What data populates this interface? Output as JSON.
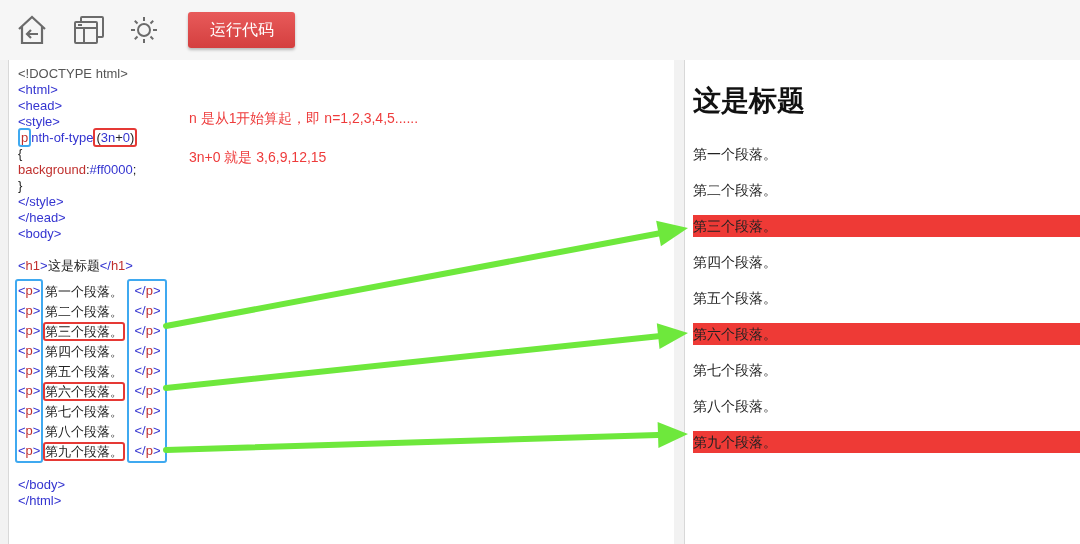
{
  "toolbar": {
    "run_button": "运行代码"
  },
  "editor": {
    "head_lines": [
      [
        {
          "text": "<!DOCTYPE html>",
          "kind": "plain"
        }
      ],
      [
        {
          "text": "<html>",
          "kind": "punct"
        }
      ],
      [
        {
          "text": "<head>",
          "kind": "punct"
        }
      ],
      [
        {
          "text": "<style>",
          "kind": "punct"
        }
      ],
      [
        {
          "text": "p",
          "kind": "tag",
          "boxed": true
        },
        {
          "text": "nth-of-type",
          "kind": "value",
          "boxed": false
        },
        {
          "kind": "group",
          "boxed": true,
          "tokens": [
            {
              "text": "(",
              "kind": "code"
            },
            {
              "text": "3n",
              "kind": "value"
            },
            {
              "text": "+",
              "kind": "code"
            },
            {
              "text": "0",
              "kind": "value"
            },
            {
              "text": ")",
              "kind": "code"
            }
          ]
        }
      ],
      [
        {
          "text": "{",
          "kind": "code"
        }
      ],
      [
        {
          "text": "background",
          "kind": "tag"
        },
        {
          "text": ":",
          "kind": "code"
        },
        {
          "text": "#ff0000",
          "kind": "value"
        },
        {
          "text": ";",
          "kind": "code"
        }
      ],
      [
        {
          "text": "}",
          "kind": "code"
        }
      ],
      [
        {
          "text": "</style>",
          "kind": "punct"
        }
      ],
      [
        {
          "text": "</head>",
          "kind": "punct"
        }
      ],
      [
        {
          "text": "<body>",
          "kind": "punct"
        }
      ]
    ],
    "heading_line": [
      {
        "text": "<",
        "kind": "punct"
      },
      {
        "text": "h1",
        "kind": "tag"
      },
      {
        "text": ">",
        "kind": "punct"
      },
      {
        "text": "这是标题",
        "kind": "code"
      },
      {
        "text": "</",
        "kind": "punct"
      },
      {
        "text": "h1",
        "kind": "tag"
      },
      {
        "text": ">",
        "kind": "punct"
      }
    ],
    "paragraph_lines": [
      {
        "open": [
          {
            "text": "<",
            "kind": "punct"
          },
          {
            "text": "p",
            "kind": "tag"
          },
          {
            "text": ">",
            "kind": "punct"
          }
        ],
        "text": "第一个段落。",
        "boxed": false,
        "close": [
          {
            "text": "</",
            "kind": "punct"
          },
          {
            "text": "p",
            "kind": "tag"
          },
          {
            "text": ">",
            "kind": "punct"
          }
        ]
      },
      {
        "open": [
          {
            "text": "<",
            "kind": "punct"
          },
          {
            "text": "p",
            "kind": "tag"
          },
          {
            "text": ">",
            "kind": "punct"
          }
        ],
        "text": "第二个段落。",
        "boxed": false,
        "close": [
          {
            "text": "</",
            "kind": "punct"
          },
          {
            "text": "p",
            "kind": "tag"
          },
          {
            "text": ">",
            "kind": "punct"
          }
        ]
      },
      {
        "open": [
          {
            "text": "<",
            "kind": "punct"
          },
          {
            "text": "p",
            "kind": "tag"
          },
          {
            "text": ">",
            "kind": "punct"
          }
        ],
        "text": "第三个段落。",
        "boxed": true,
        "close": [
          {
            "text": "</",
            "kind": "punct"
          },
          {
            "text": "p",
            "kind": "tag"
          },
          {
            "text": ">",
            "kind": "punct"
          }
        ]
      },
      {
        "open": [
          {
            "text": "<",
            "kind": "punct"
          },
          {
            "text": "p",
            "kind": "tag"
          },
          {
            "text": ">",
            "kind": "punct"
          }
        ],
        "text": "第四个段落。",
        "boxed": false,
        "close": [
          {
            "text": "</",
            "kind": "punct"
          },
          {
            "text": "p",
            "kind": "tag"
          },
          {
            "text": ">",
            "kind": "punct"
          }
        ]
      },
      {
        "open": [
          {
            "text": "<",
            "kind": "punct"
          },
          {
            "text": "p",
            "kind": "tag"
          },
          {
            "text": ">",
            "kind": "punct"
          }
        ],
        "text": "第五个段落。",
        "boxed": false,
        "close": [
          {
            "text": "</",
            "kind": "punct"
          },
          {
            "text": "p",
            "kind": "tag"
          },
          {
            "text": ">",
            "kind": "punct"
          }
        ]
      },
      {
        "open": [
          {
            "text": "<",
            "kind": "punct"
          },
          {
            "text": "p",
            "kind": "tag"
          },
          {
            "text": ">",
            "kind": "punct"
          }
        ],
        "text": "第六个段落。",
        "boxed": true,
        "close": [
          {
            "text": "</",
            "kind": "punct"
          },
          {
            "text": "p",
            "kind": "tag"
          },
          {
            "text": ">",
            "kind": "punct"
          }
        ]
      },
      {
        "open": [
          {
            "text": "<",
            "kind": "punct"
          },
          {
            "text": "p",
            "kind": "tag"
          },
          {
            "text": ">",
            "kind": "punct"
          }
        ],
        "text": "第七个段落。",
        "boxed": false,
        "close": [
          {
            "text": "</",
            "kind": "punct"
          },
          {
            "text": "p",
            "kind": "tag"
          },
          {
            "text": ">",
            "kind": "punct"
          }
        ]
      },
      {
        "open": [
          {
            "text": "<",
            "kind": "punct"
          },
          {
            "text": "p",
            "kind": "tag"
          },
          {
            "text": ">",
            "kind": "punct"
          }
        ],
        "text": "第八个段落。",
        "boxed": false,
        "close": [
          {
            "text": "</",
            "kind": "punct"
          },
          {
            "text": "p",
            "kind": "tag"
          },
          {
            "text": ">",
            "kind": "punct"
          }
        ]
      },
      {
        "open": [
          {
            "text": "<",
            "kind": "punct"
          },
          {
            "text": "p",
            "kind": "tag"
          },
          {
            "text": ">",
            "kind": "punct"
          }
        ],
        "text": "第九个段落。",
        "boxed": true,
        "close": [
          {
            "text": "</",
            "kind": "punct"
          },
          {
            "text": "p",
            "kind": "tag"
          },
          {
            "text": ">",
            "kind": "punct"
          }
        ]
      }
    ],
    "tail_lines": [
      [
        {
          "text": "</body>",
          "kind": "punct"
        }
      ],
      [
        {
          "text": "</html>",
          "kind": "punct"
        }
      ]
    ]
  },
  "notes": [
    "n 是从1开始算起，即 n=1,2,3,4,5......",
    "3n+0 就是 3,6,9,12,15"
  ],
  "preview": {
    "heading": "这是标题",
    "paragraphs": [
      {
        "text": "第一个段落。",
        "highlighted": false
      },
      {
        "text": "第二个段落。",
        "highlighted": false
      },
      {
        "text": "第三个段落。",
        "highlighted": true
      },
      {
        "text": "第四个段落。",
        "highlighted": false
      },
      {
        "text": "第五个段落。",
        "highlighted": false
      },
      {
        "text": "第六个段落。",
        "highlighted": true
      },
      {
        "text": "第七个段落。",
        "highlighted": false
      },
      {
        "text": "第八个段落。",
        "highlighted": false
      },
      {
        "text": "第九个段落。",
        "highlighted": true
      }
    ]
  }
}
